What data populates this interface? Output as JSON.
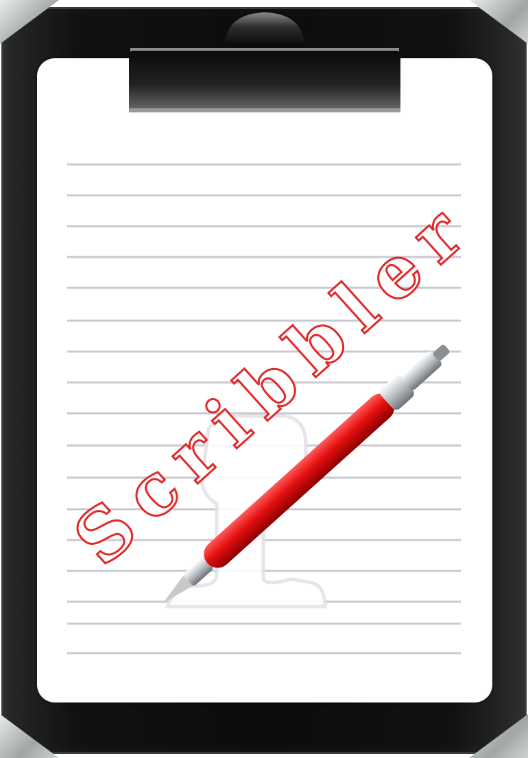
{
  "title": "Scribbler",
  "colors": {
    "board": "#111111",
    "paper": "#ffffff",
    "rule_lines": "#c9c9d3",
    "title_red": "#e02828",
    "pen_red": "#e30f0f",
    "pen_metal": "#b9bec2"
  },
  "icons": [
    "clipboard-icon",
    "pen-icon"
  ]
}
